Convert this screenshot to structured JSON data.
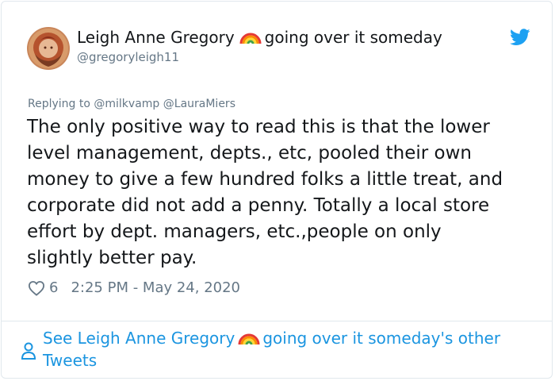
{
  "author": {
    "name_part1": "Leigh Anne Gregory",
    "rainbow_emoji": "rainbow-emoji",
    "name_part2": "going over it someday",
    "handle": "@gregoryleigh11"
  },
  "reply": {
    "prefix": "Replying to",
    "mentions": [
      "@milkvamp",
      "@LauraMiers"
    ]
  },
  "tweet": {
    "text": "The only positive way to read this is that the lower\nlevel management, depts., etc, pooled their own\nmoney to give a few hundred folks a little treat, and\ncorporate did not add a penny. Totally a local store\neffort by dept. managers, etc.,people on only\nslightly better pay."
  },
  "meta": {
    "likes": "6",
    "timestamp": "2:25 PM - May 24, 2020"
  },
  "footer": {
    "link_part1": "See Leigh Anne Gregory",
    "link_part2": "going over it someday's other",
    "link_part3": "Tweets"
  },
  "colors": {
    "link": "#1b95e0",
    "muted": "#657786",
    "text": "#14171a",
    "border": "#e1e8ed",
    "twitter_blue": "#1da1f2"
  },
  "icons": [
    "twitter-bird-icon",
    "heart-icon",
    "person-icon",
    "rainbow-emoji"
  ]
}
